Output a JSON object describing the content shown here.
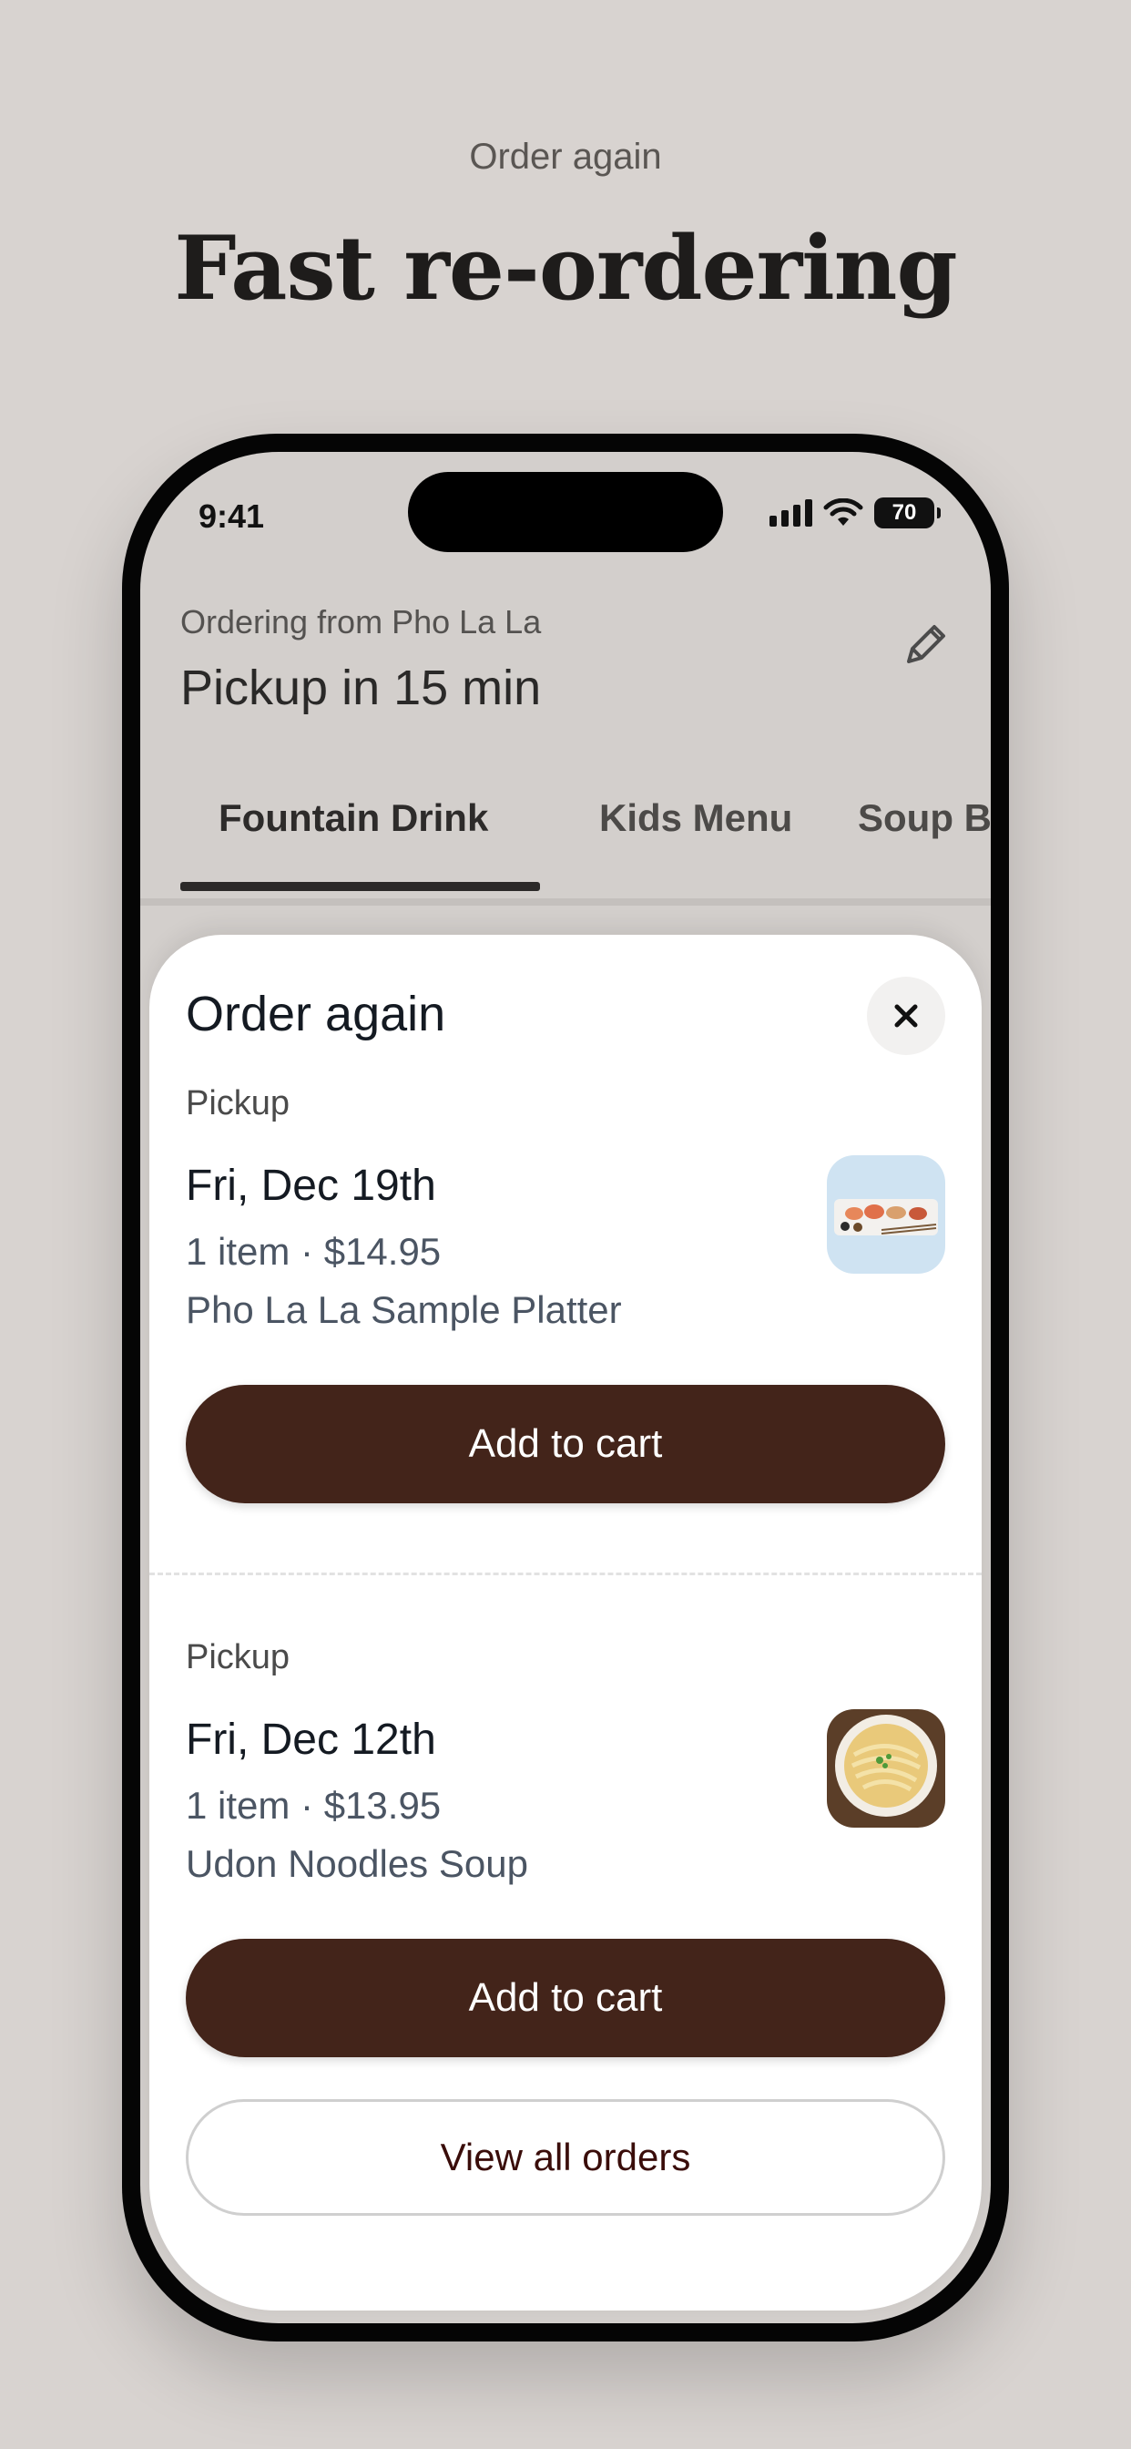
{
  "promo": {
    "subtitle": "Order again",
    "title": "Fast re-ordering"
  },
  "status_bar": {
    "time": "9:41",
    "battery": "70",
    "icons": [
      "signal-icon",
      "wifi-icon",
      "battery-icon"
    ]
  },
  "header": {
    "ordering_from": "Ordering from Pho La La",
    "pickup": "Pickup in 15 min",
    "edit_icon": "pencil-icon"
  },
  "tabs": [
    {
      "label": "Fountain Drink",
      "active": true
    },
    {
      "label": "Kids Menu",
      "active": false
    },
    {
      "label": "Soup B",
      "active": false
    }
  ],
  "sheet": {
    "title": "Order again",
    "close_icon": "close-icon",
    "orders": [
      {
        "kind": "Pickup",
        "date": "Fri, Dec 19th",
        "meta": "1 item · $14.95",
        "name": "Pho La La Sample Platter",
        "image": "sample-platter-photo",
        "button": "Add to cart"
      },
      {
        "kind": "Pickup",
        "date": "Fri, Dec 12th",
        "meta": "1 item · $13.95",
        "name": "Udon Noodles Soup",
        "image": "udon-soup-photo",
        "button": "Add to cart"
      }
    ],
    "view_all": "View all orders"
  },
  "colors": {
    "background": "#d8d3d0",
    "brand_button": "#43241a",
    "view_all_text": "#3a0d0a"
  }
}
